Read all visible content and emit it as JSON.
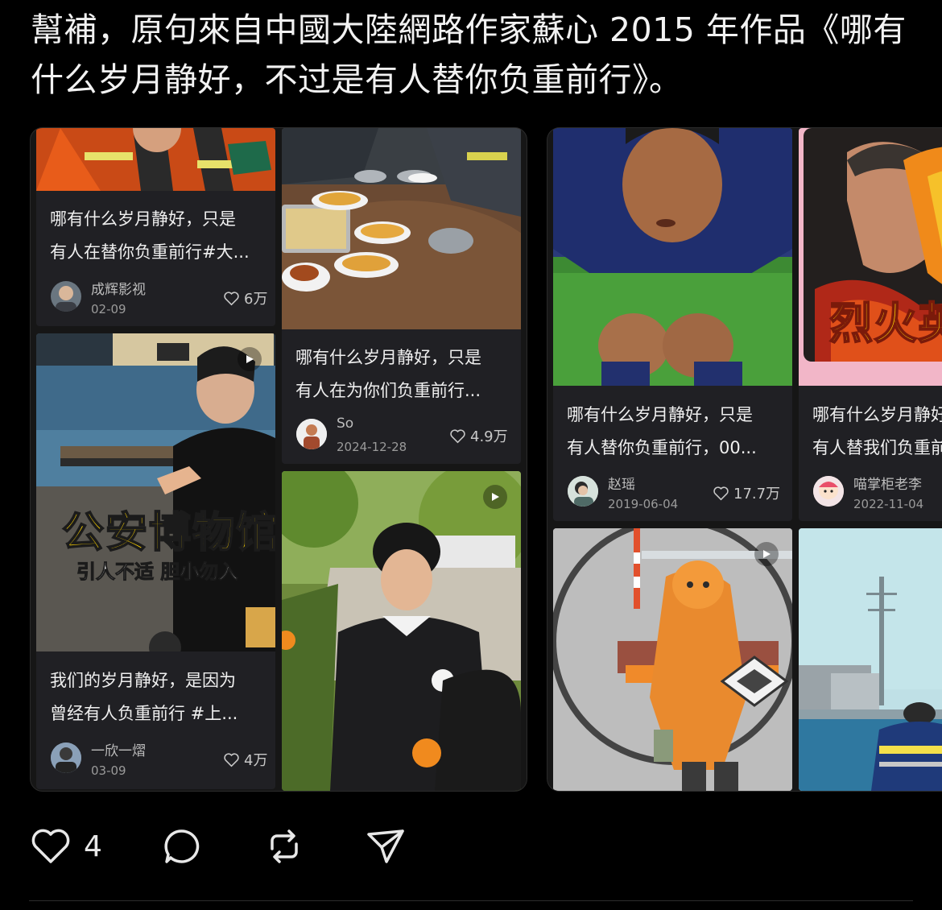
{
  "post": {
    "text": "幫補，原句來自中國大陸網路作家蘇心 2015 年作品《哪有什么岁月静好，不过是有人替你负重前行》。"
  },
  "screenshot_left": {
    "cards": [
      {
        "caption_line1": "哪有什么岁月静好，只是",
        "caption_line2": "有人在替你负重前行#大...",
        "author": "成辉影视",
        "date": "02-09",
        "likes": "6万"
      },
      {
        "caption_line1": "我们的岁月静好，是因为",
        "caption_line2": "曾经有人负重前行 #上...",
        "author": "一欣一熠",
        "date": "03-09",
        "likes": "4万",
        "overlay_title": "公安博物馆",
        "overlay_subtitle": "引人不适 胆小勿入"
      },
      {
        "caption_line1": "哪有什么岁月静好，只是",
        "caption_line2": "有人在为你们负重前行...",
        "author": "So",
        "date": "2024-12-28",
        "likes": "4.9万"
      }
    ]
  },
  "screenshot_right": {
    "cards": [
      {
        "caption_line1": "哪有什么岁月静好，只是",
        "caption_line2": "有人替你负重前行，00...",
        "author": "赵瑶",
        "date": "2019-06-04",
        "likes": "17.7万"
      },
      {
        "caption_line1": "哪有什么岁月静好",
        "caption_line2": "有人替我们负重前行",
        "author": "喵掌柜老李",
        "date": "2022-11-04",
        "likes": "",
        "overlay_title": "烈火英"
      }
    ]
  },
  "actions": {
    "like_count": "4"
  },
  "icons": {
    "like": "heart-icon",
    "comment": "comment-bubble-icon",
    "repost": "repost-icon",
    "share": "send-icon",
    "play": "play-icon"
  },
  "colors": {
    "background": "#000000",
    "card": "#202024",
    "text": "#f2f2f2",
    "muted": "#9a9a9a",
    "overlay_title": "#ffd400"
  }
}
